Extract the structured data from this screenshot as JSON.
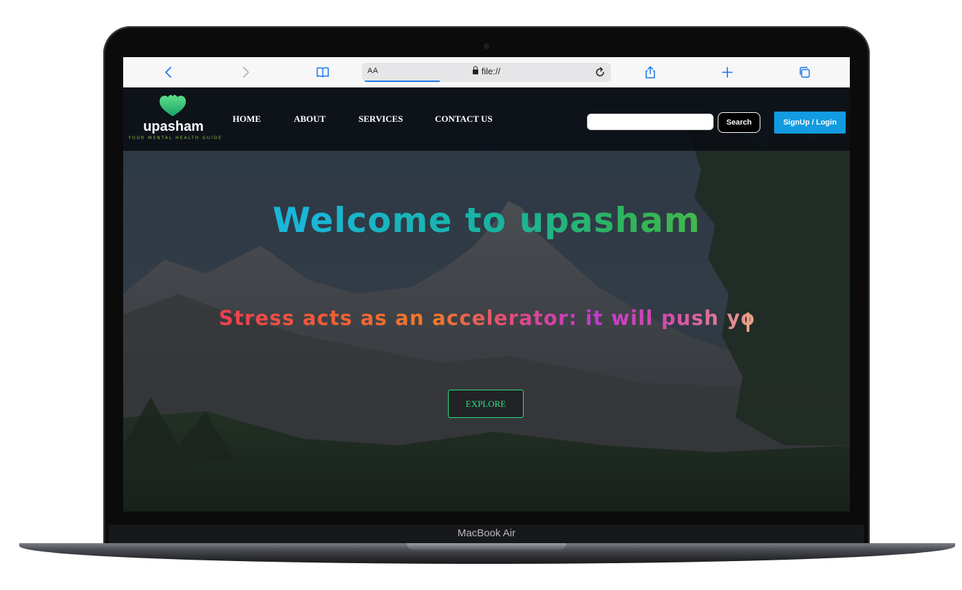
{
  "device": {
    "model_label": "MacBook Air"
  },
  "browser": {
    "address_prefix": "AA",
    "url": "file://",
    "load_progress": 0.3
  },
  "site": {
    "logo": {
      "name": "upasham",
      "tagline": "YOUR MENTAL HEALTH GUIDE"
    },
    "nav": [
      "HOME",
      "ABOUT",
      "SERVICES",
      "CONTACT US"
    ],
    "search": {
      "value": "",
      "button_label": "Search"
    },
    "signup_label": "SignUp / Login",
    "hero": {
      "title": "Welcome to upasham",
      "subtitle": "Stress acts as an accelerator: it will push you",
      "cta_label": "EXPLORE"
    },
    "colors": {
      "accent_blue": "#129be0",
      "explore_green": "#2ee08a",
      "logo_green": "#3fd17a"
    }
  }
}
